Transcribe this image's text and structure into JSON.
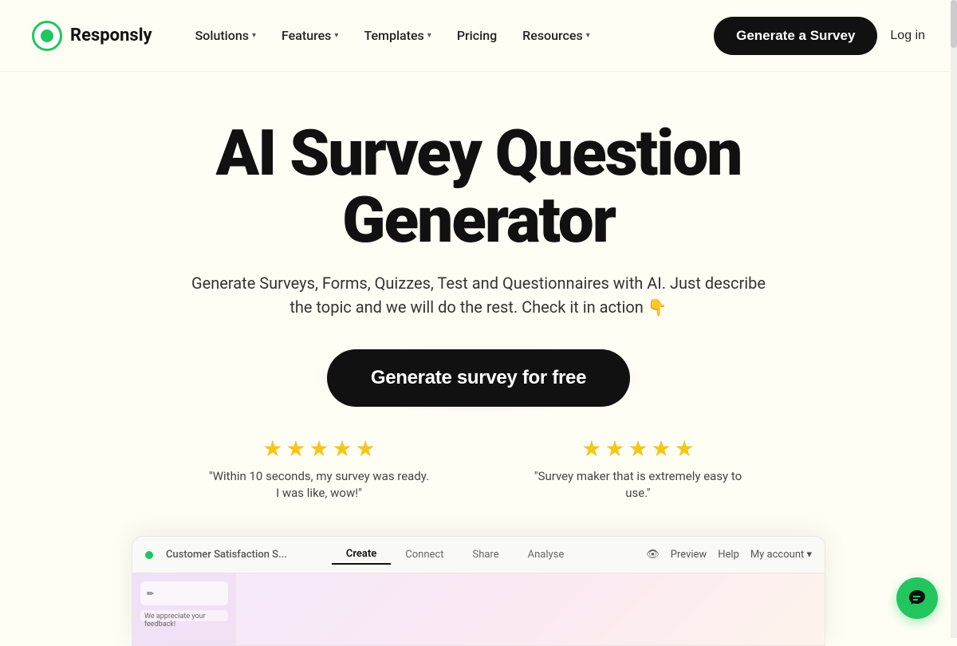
{
  "logo": {
    "text": "Responsly"
  },
  "nav": {
    "items": [
      {
        "id": "solutions",
        "label": "Solutions",
        "hasDropdown": true
      },
      {
        "id": "features",
        "label": "Features",
        "hasDropdown": true
      },
      {
        "id": "templates",
        "label": "Templates",
        "hasDropdown": true
      },
      {
        "id": "pricing",
        "label": "Pricing",
        "hasDropdown": false
      },
      {
        "id": "resources",
        "label": "Resources",
        "hasDropdown": true
      }
    ],
    "cta_label": "Generate a Survey",
    "login_label": "Log in"
  },
  "hero": {
    "title": "AI Survey Question Generator",
    "subtitle": "Generate Surveys, Forms, Quizzes, Test and Questionnaires with AI. Just describe the topic and we will do the rest. Check it in action 👇",
    "cta_label": "Generate survey for free"
  },
  "reviews": [
    {
      "stars": 5,
      "text": "\"Within 10 seconds, my survey was ready. I was like, wow!\""
    },
    {
      "stars": 5,
      "text": "\"Survey maker that is extremely easy to use.\""
    }
  ],
  "preview": {
    "title": "Customer Satisfaction S...",
    "tabs": [
      "Create",
      "Connect",
      "Share",
      "Analyse"
    ],
    "active_tab": "Create",
    "actions": [
      "Preview",
      "Help",
      "My account"
    ]
  },
  "chat": {
    "icon": "💬"
  }
}
